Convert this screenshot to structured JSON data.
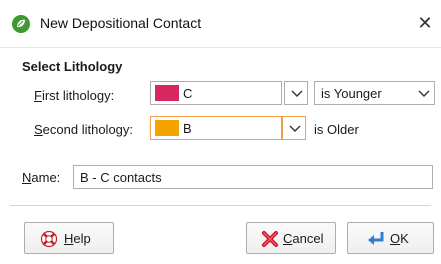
{
  "window": {
    "title": "New Depositional Contact",
    "close_glyph": "✕"
  },
  "section": {
    "label": "Select Lithology"
  },
  "first": {
    "label_mnemonic": "F",
    "label_rest": "irst lithology:",
    "value": "C",
    "swatch_color": "#d6285f"
  },
  "relation": {
    "value": "is Younger"
  },
  "second": {
    "label_mnemonic": "S",
    "label_rest": "econd lithology:",
    "value": "B",
    "swatch_color": "#f5a300",
    "relation_text": "is Older"
  },
  "name": {
    "label_mnemonic": "N",
    "label_rest": "ame:",
    "value": "B - C contacts"
  },
  "buttons": {
    "help": {
      "mnemonic": "H",
      "rest": "elp",
      "icon": "lifebuoy-icon"
    },
    "cancel": {
      "mnemonic": "C",
      "rest": "ancel",
      "icon": "red-x-icon"
    },
    "ok": {
      "mnemonic": "O",
      "rest": "K",
      "icon": "arrow-return-icon"
    }
  },
  "colors": {
    "accent_focus": "#f2a04b",
    "app_icon": "#3d9a2f"
  }
}
